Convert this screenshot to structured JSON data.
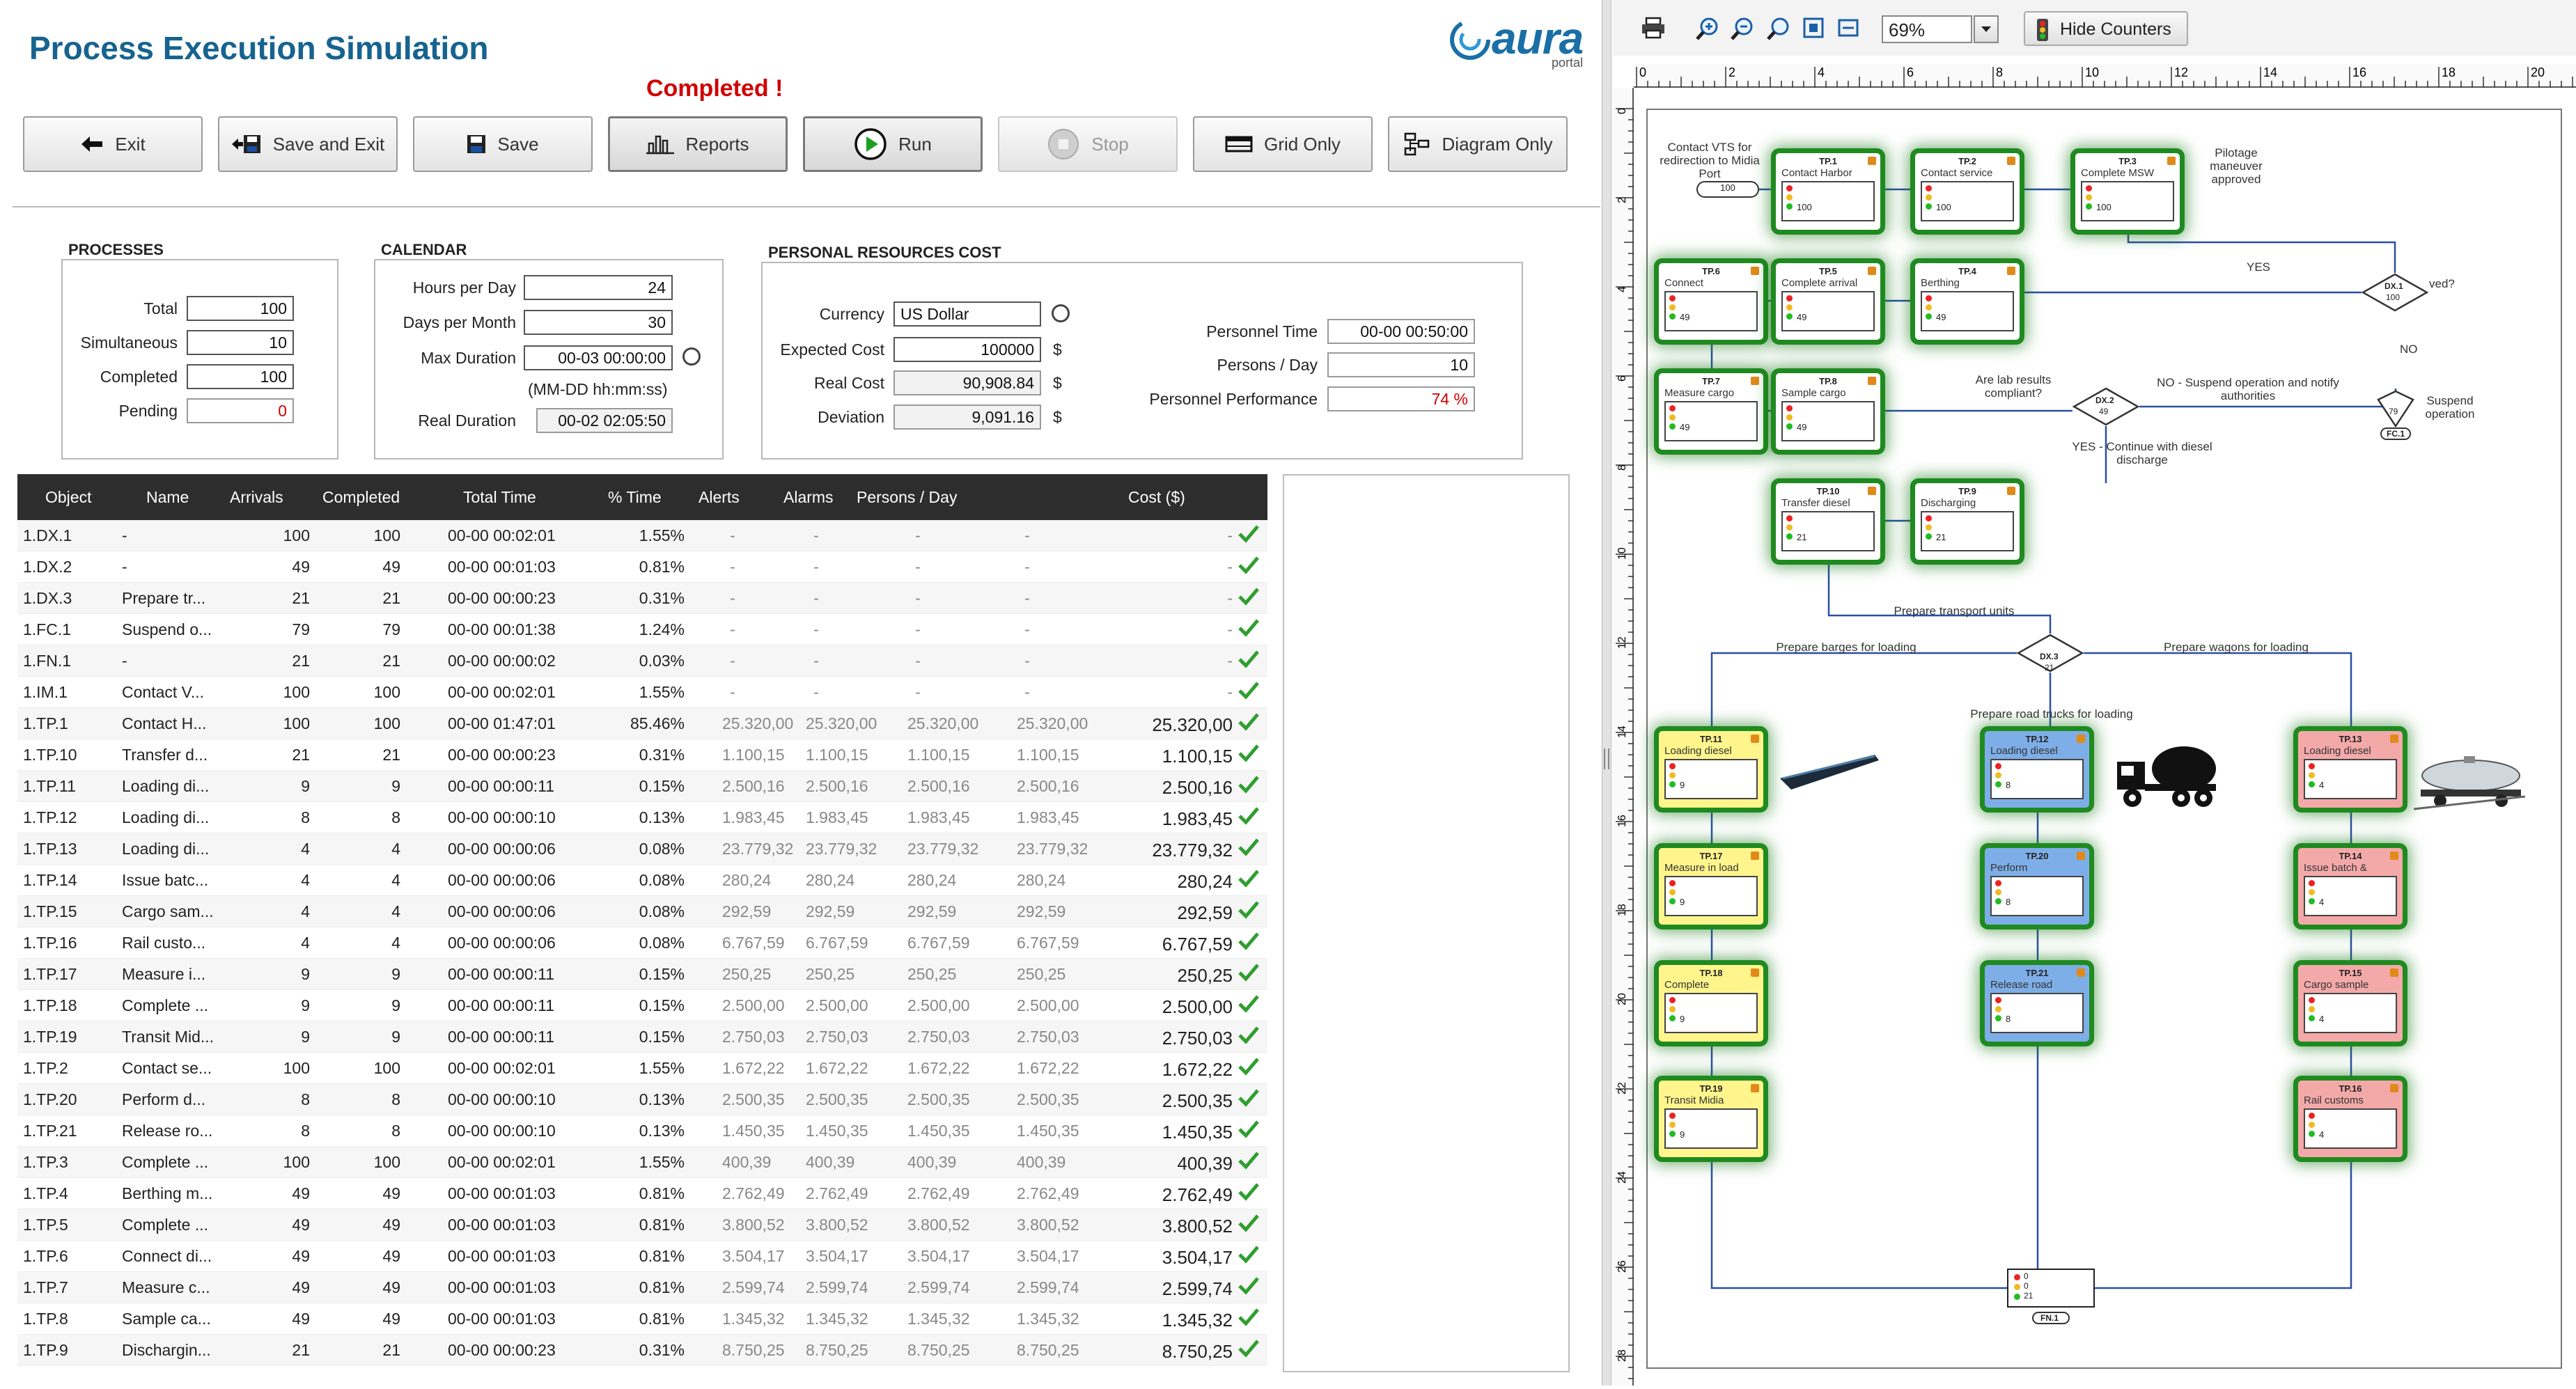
{
  "app": {
    "title": "Process Execution Simulation",
    "status": "Completed !",
    "logo_text": "aura",
    "logo_sub": "portal"
  },
  "toolbar": {
    "exit": "Exit",
    "save_exit": "Save and Exit",
    "save": "Save",
    "reports": "Reports",
    "run": "Run",
    "stop": "Stop",
    "grid_only": "Grid Only",
    "diagram_only": "Diagram Only"
  },
  "processes": {
    "heading": "PROCESSES",
    "total_label": "Total",
    "total": "100",
    "simultaneous_label": "Simultaneous",
    "simultaneous": "10",
    "completed_label": "Completed",
    "completed": "100",
    "pending_label": "Pending",
    "pending": "0"
  },
  "calendar": {
    "heading": "CALENDAR",
    "hours_label": "Hours per Day",
    "hours": "24",
    "days_label": "Days per Month",
    "days": "30",
    "max_label": "Max Duration",
    "max": "00-03 00:00:00",
    "format_hint": "(MM-DD hh:mm:ss)",
    "real_label": "Real Duration",
    "real": "00-02 02:05:50"
  },
  "resources": {
    "heading": "PERSONAL RESOURCES COST",
    "currency_label": "Currency",
    "currency": "US Dollar",
    "expected_label": "Expected Cost",
    "expected": "100000",
    "real_label": "Real Cost",
    "real": "90,908.84",
    "deviation_label": "Deviation",
    "deviation": "9,091.16",
    "unit": "$",
    "ptime_label": "Personnel Time",
    "ptime": "00-00 00:50:00",
    "ppd_label": "Persons / Day",
    "ppd": "10",
    "perf_label": "Personnel Performance",
    "perf": "74 %"
  },
  "grid": {
    "headers": [
      "Object",
      "Name",
      "Arrivals",
      "Completed",
      "Total Time",
      "% Time",
      "Alerts",
      "Alarms",
      "Persons / Day",
      "Cost ($)"
    ],
    "rows": [
      [
        "1.DX.1",
        "-",
        "100",
        "100",
        "00-00 00:02:01",
        "1.55%",
        "-"
      ],
      [
        "1.DX.2",
        "-",
        "49",
        "49",
        "00-00 00:01:03",
        "0.81%",
        "-"
      ],
      [
        "1.DX.3",
        "Prepare tr...",
        "21",
        "21",
        "00-00 00:00:23",
        "0.31%",
        "-"
      ],
      [
        "1.FC.1",
        "Suspend o...",
        "79",
        "79",
        "00-00 00:01:38",
        "1.24%",
        "-"
      ],
      [
        "1.FN.1",
        "-",
        "21",
        "21",
        "00-00 00:00:02",
        "0.03%",
        "-"
      ],
      [
        "1.IM.1",
        "Contact V...",
        "100",
        "100",
        "00-00 00:02:01",
        "1.55%",
        "-"
      ],
      [
        "1.TP.1",
        "Contact H...",
        "100",
        "100",
        "00-00 01:47:01",
        "85.46%",
        "25.320,00"
      ],
      [
        "1.TP.10",
        "Transfer d...",
        "21",
        "21",
        "00-00 00:00:23",
        "0.31%",
        "1.100,15"
      ],
      [
        "1.TP.11",
        "Loading di...",
        "9",
        "9",
        "00-00 00:00:11",
        "0.15%",
        "2.500,16"
      ],
      [
        "1.TP.12",
        "Loading di...",
        "8",
        "8",
        "00-00 00:00:10",
        "0.13%",
        "1.983,45"
      ],
      [
        "1.TP.13",
        "Loading di...",
        "4",
        "4",
        "00-00 00:00:06",
        "0.08%",
        "23.779,32"
      ],
      [
        "1.TP.14",
        "Issue batc...",
        "4",
        "4",
        "00-00 00:00:06",
        "0.08%",
        "280,24"
      ],
      [
        "1.TP.15",
        "Cargo sam...",
        "4",
        "4",
        "00-00 00:00:06",
        "0.08%",
        "292,59"
      ],
      [
        "1.TP.16",
        "Rail custo...",
        "4",
        "4",
        "00-00 00:00:06",
        "0.08%",
        "6.767,59"
      ],
      [
        "1.TP.17",
        "Measure i...",
        "9",
        "9",
        "00-00 00:00:11",
        "0.15%",
        "250,25"
      ],
      [
        "1.TP.18",
        "Complete ...",
        "9",
        "9",
        "00-00 00:00:11",
        "0.15%",
        "2.500,00"
      ],
      [
        "1.TP.19",
        "Transit Mid...",
        "9",
        "9",
        "00-00 00:00:11",
        "0.15%",
        "2.750,03"
      ],
      [
        "1.TP.2",
        "Contact se...",
        "100",
        "100",
        "00-00 00:02:01",
        "1.55%",
        "1.672,22"
      ],
      [
        "1.TP.20",
        "Perform d...",
        "8",
        "8",
        "00-00 00:00:10",
        "0.13%",
        "2.500,35"
      ],
      [
        "1.TP.21",
        "Release ro...",
        "8",
        "8",
        "00-00 00:00:10",
        "0.13%",
        "1.450,35"
      ],
      [
        "1.TP.3",
        "Complete ...",
        "100",
        "100",
        "00-00 00:02:01",
        "1.55%",
        "400,39"
      ],
      [
        "1.TP.4",
        "Berthing m...",
        "49",
        "49",
        "00-00 00:01:03",
        "0.81%",
        "2.762,49"
      ],
      [
        "1.TP.5",
        "Complete ...",
        "49",
        "49",
        "00-00 00:01:03",
        "0.81%",
        "3.800,52"
      ],
      [
        "1.TP.6",
        "Connect di...",
        "49",
        "49",
        "00-00 00:01:03",
        "0.81%",
        "3.504,17"
      ],
      [
        "1.TP.7",
        "Measure c...",
        "49",
        "49",
        "00-00 00:01:03",
        "0.81%",
        "2.599,74"
      ],
      [
        "1.TP.8",
        "Sample ca...",
        "49",
        "49",
        "00-00 00:01:03",
        "0.81%",
        "1.345,32"
      ],
      [
        "1.TP.9",
        "Dischargin...",
        "21",
        "21",
        "00-00 00:00:23",
        "0.31%",
        "8.750,25"
      ]
    ]
  },
  "diagram_toolbar": {
    "zoom": "69%",
    "hide_counters": "Hide Counters",
    "ruler_top": [
      "0",
      "2",
      "4",
      "6",
      "8",
      "10",
      "12",
      "14",
      "16",
      "18",
      "20"
    ],
    "ruler_left": [
      "0",
      "2",
      "4",
      "6",
      "8",
      "10",
      "12",
      "14",
      "16",
      "18",
      "20",
      "22",
      "24",
      "26",
      "28"
    ]
  },
  "diagram": {
    "nodes": [
      {
        "id": "TP.1",
        "title": "Contact Harbor",
        "count": "100",
        "color": "white"
      },
      {
        "id": "TP.2",
        "title": "Contact service",
        "count": "100",
        "color": "white"
      },
      {
        "id": "TP.3",
        "title": "Complete MSW",
        "count": "100",
        "color": "white"
      },
      {
        "id": "TP.6",
        "title": "Connect",
        "count": "49",
        "color": "white"
      },
      {
        "id": "TP.5",
        "title": "Complete arrival",
        "count": "49",
        "color": "white"
      },
      {
        "id": "TP.4",
        "title": "Berthing",
        "count": "49",
        "color": "white"
      },
      {
        "id": "TP.7",
        "title": "Measure cargo",
        "count": "49",
        "color": "white"
      },
      {
        "id": "TP.8",
        "title": "Sample cargo",
        "count": "49",
        "color": "white"
      },
      {
        "id": "TP.10",
        "title": "Transfer diesel",
        "count": "21",
        "color": "white"
      },
      {
        "id": "TP.9",
        "title": "Discharging",
        "count": "21",
        "color": "white"
      },
      {
        "id": "TP.11",
        "title": "Loading diesel",
        "count": "9",
        "color": "yellow"
      },
      {
        "id": "TP.12",
        "title": "Loading diesel",
        "count": "8",
        "color": "blue"
      },
      {
        "id": "TP.13",
        "title": "Loading diesel",
        "count": "4",
        "color": "pink"
      },
      {
        "id": "TP.17",
        "title": "Measure in load",
        "count": "9",
        "color": "yellow"
      },
      {
        "id": "TP.20",
        "title": "Perform",
        "count": "8",
        "color": "blue"
      },
      {
        "id": "TP.14",
        "title": "Issue batch &",
        "count": "4",
        "color": "pink"
      },
      {
        "id": "TP.18",
        "title": "Complete",
        "count": "9",
        "color": "yellow"
      },
      {
        "id": "TP.21",
        "title": "Release road",
        "count": "8",
        "color": "blue"
      },
      {
        "id": "TP.15",
        "title": "Cargo sample",
        "count": "4",
        "color": "pink"
      },
      {
        "id": "TP.19",
        "title": "Transit Midia",
        "count": "9",
        "color": "yellow"
      },
      {
        "id": "TP.16",
        "title": "Rail customs",
        "count": "4",
        "color": "pink"
      }
    ],
    "start_label": "Contact VTS for redirection to Midia Port",
    "start_count": "100",
    "pilotage": "Pilotage maneuver approved",
    "dx1": "DX.1",
    "dx1_count": "100",
    "dx1_q": "ved?",
    "yes": "YES",
    "no": "NO",
    "lab": "Are lab results compliant?",
    "dx2": "DX.2",
    "dx2_count": "49",
    "no_suspend": "NO - Suspend operation and notify authorities",
    "suspend": "Suspend operation",
    "fc1": "FC.1",
    "fc1_count": "79",
    "yes_continue": "YES - Continue with diesel discharge",
    "prepare_transport": "Prepare transport units",
    "dx3": "DX.3",
    "dx3_count": "21",
    "barges": "Prepare barges for loading",
    "wagons": "Prepare wagons for loading",
    "trucks": "Prepare road trucks for loading",
    "fn1": "FN.1",
    "fn1_counts": [
      "0",
      "0",
      "21"
    ]
  },
  "colors": {
    "accent": "#17638f",
    "status": "#d00000",
    "check": "#2e9e2e",
    "node_glow": "#1f8a1f"
  }
}
